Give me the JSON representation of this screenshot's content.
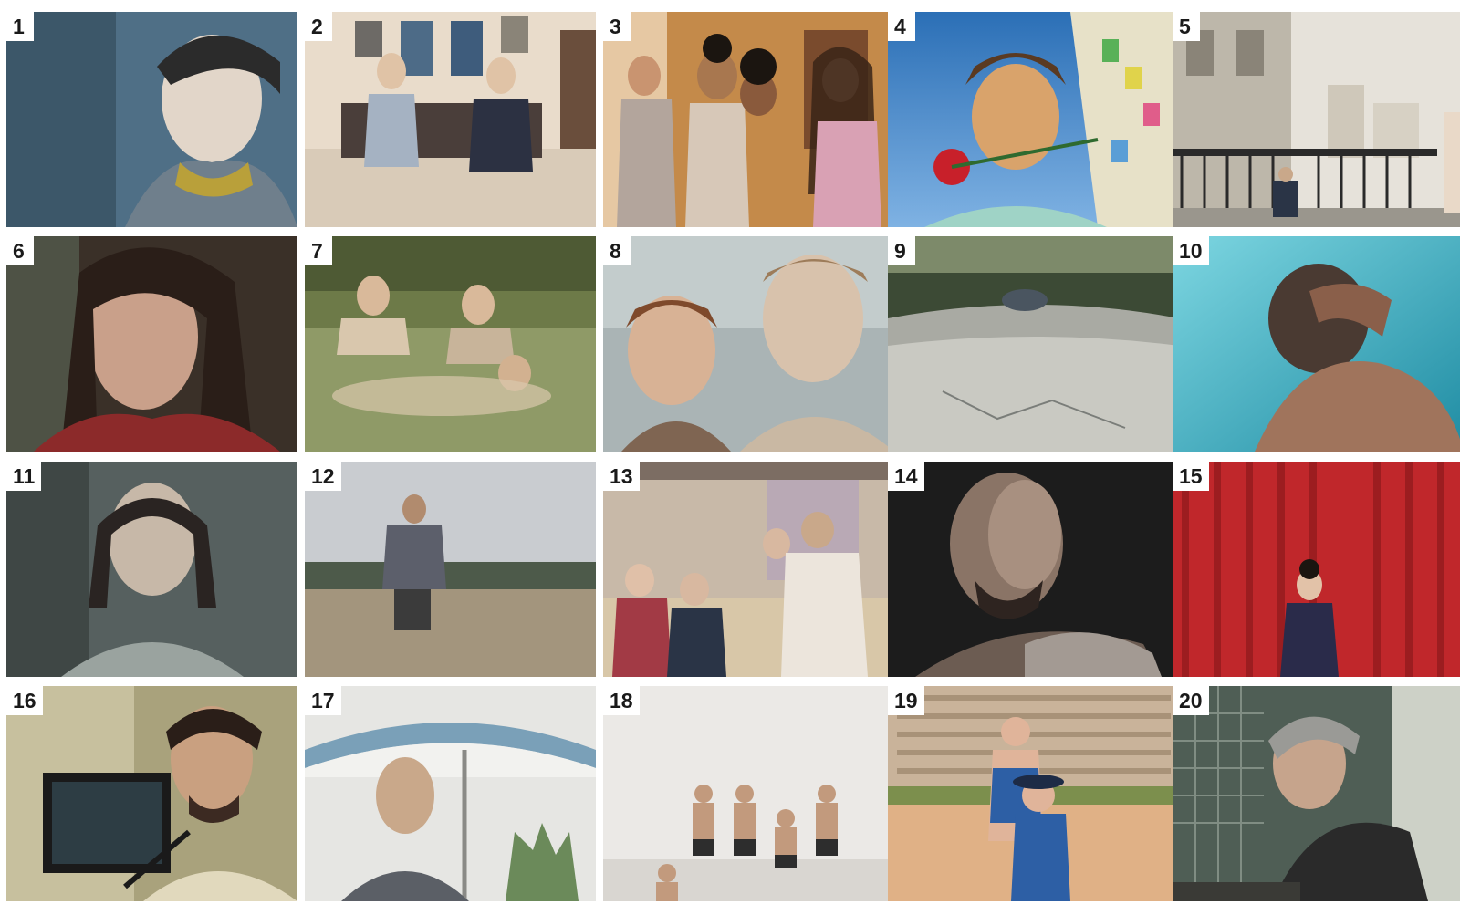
{
  "tiles": [
    {
      "number": "1",
      "scene": "woman-closeup-still",
      "palette": [
        "#4f6f86",
        "#9fb5c2",
        "#e2d6c9"
      ]
    },
    {
      "number": "2",
      "scene": "two-women-bed-still",
      "palette": [
        "#e9dccb",
        "#6a4e3c",
        "#2c3142"
      ]
    },
    {
      "number": "3",
      "scene": "group-of-women-still",
      "palette": [
        "#c48a4a",
        "#7a4b2d",
        "#e6c8a3"
      ]
    },
    {
      "number": "4",
      "scene": "man-with-rose-still",
      "palette": [
        "#2b6fb6",
        "#7fb2e3",
        "#d9a36b"
      ]
    },
    {
      "number": "5",
      "scene": "rooftop-city-still",
      "palette": [
        "#d7d1c4",
        "#8a8478",
        "#2a2a2a"
      ]
    },
    {
      "number": "6",
      "scene": "woman-wet-hair-still",
      "palette": [
        "#3a3028",
        "#8a5a44",
        "#8c2a2a"
      ]
    },
    {
      "number": "7",
      "scene": "women-in-river-still",
      "palette": [
        "#6d7a48",
        "#a7b27a",
        "#d9c7ad"
      ]
    },
    {
      "number": "8",
      "scene": "two-men-faces-still",
      "palette": [
        "#aab4b5",
        "#7f6552",
        "#d8c2ac"
      ]
    },
    {
      "number": "9",
      "scene": "empty-road-still",
      "palette": [
        "#7a7d79",
        "#c9c9c2",
        "#3c4a35"
      ]
    },
    {
      "number": "10",
      "scene": "man-underwater-still",
      "palette": [
        "#2aa3b9",
        "#7dd6e1",
        "#4a3a32"
      ]
    },
    {
      "number": "11",
      "scene": "man-with-braids-still",
      "palette": [
        "#56605f",
        "#9aa39f",
        "#c7b8a8"
      ]
    },
    {
      "number": "12",
      "scene": "man-in-field-still",
      "palette": [
        "#c9ccd0",
        "#a3957d",
        "#3b3b3b"
      ]
    },
    {
      "number": "13",
      "scene": "people-at-table-still",
      "palette": [
        "#c8b9a8",
        "#7c6d63",
        "#ece5dc"
      ]
    },
    {
      "number": "14",
      "scene": "bald-man-dark-still",
      "palette": [
        "#1c1c1c",
        "#6c5c52",
        "#a39a93"
      ]
    },
    {
      "number": "15",
      "scene": "woman-red-curtain-still",
      "palette": [
        "#c0272b",
        "#7a1417",
        "#2a2b4a"
      ]
    },
    {
      "number": "16",
      "scene": "man-with-headphones-still",
      "palette": [
        "#a9a27c",
        "#3c3a2e",
        "#e1d9bd"
      ]
    },
    {
      "number": "17",
      "scene": "man-under-parasol-still",
      "palette": [
        "#e6e6e3",
        "#7aa0b8",
        "#5b5f66"
      ]
    },
    {
      "number": "18",
      "scene": "men-in-swimwear-still",
      "palette": [
        "#ebe9e6",
        "#c29a7d",
        "#2d2d2d"
      ]
    },
    {
      "number": "19",
      "scene": "beach-bathers-still",
      "palette": [
        "#e0b186",
        "#2d5fa5",
        "#7c8f4d"
      ]
    },
    {
      "number": "20",
      "scene": "older-man-piano-still",
      "palette": [
        "#4f5e55",
        "#a2ada2",
        "#2a2a2a"
      ]
    }
  ]
}
